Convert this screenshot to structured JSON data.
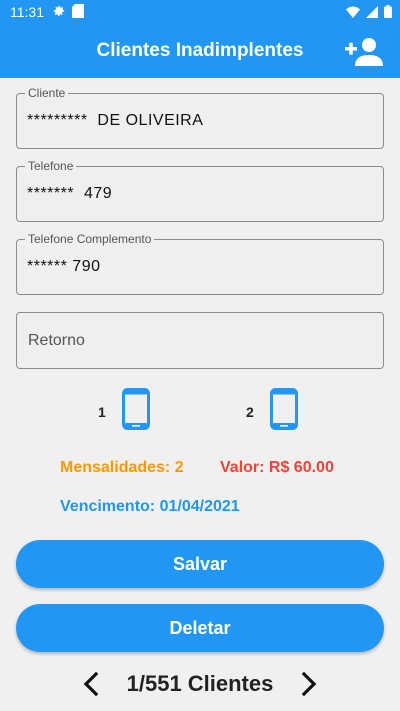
{
  "status_bar": {
    "time": "11:31",
    "left_icons": [
      "gear-icon",
      "sim-card-icon"
    ],
    "right_icons": [
      "wifi-icon",
      "signal-icon",
      "battery-icon"
    ]
  },
  "app_bar": {
    "title": "Clientes Inadimplentes",
    "action_icon": "add-person-icon"
  },
  "form": {
    "cliente": {
      "label": "Cliente",
      "value": "*********  DE OLIVEIRA"
    },
    "telefone": {
      "label": "Telefone",
      "value": "*******  479"
    },
    "telefone_complemento": {
      "label": "Telefone Complemento",
      "value": "****** 790"
    },
    "retorno": {
      "placeholder": "Retorno",
      "value": ""
    }
  },
  "phones": [
    {
      "number": "1",
      "icon": "smartphone-icon"
    },
    {
      "number": "2",
      "icon": "smartphone-icon"
    }
  ],
  "info": {
    "mensalidades": "Mensalidades: 2",
    "valor": "Valor: R$ 60.00",
    "vencimento": "Vencimento: 01/04/2021"
  },
  "buttons": {
    "salvar": "Salvar",
    "deletar": "Deletar"
  },
  "pager": {
    "current_total": "1/551",
    "suffix": "Clientes"
  },
  "colors": {
    "primary": "#2196f3",
    "mensalidades": "#ff9800",
    "valor": "#f44336",
    "vencimento": "#2196f3"
  }
}
